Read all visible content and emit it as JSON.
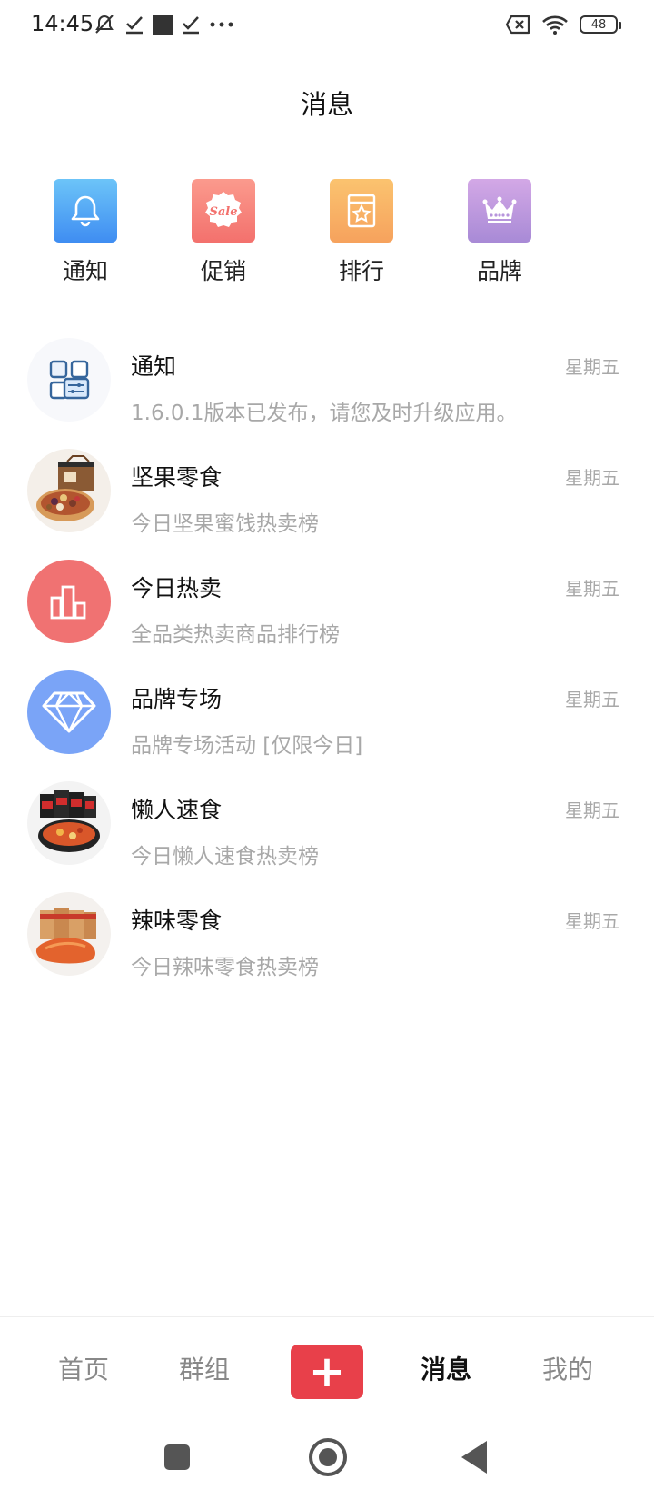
{
  "status_bar": {
    "time": "14:45",
    "left_icons": [
      "mute-icon",
      "check-icon",
      "square-icon",
      "check-icon",
      "more-icon"
    ],
    "right_icons": [
      "sim-off-icon",
      "wifi-icon",
      "battery-icon"
    ],
    "battery_level": "48"
  },
  "header": {
    "title": "消息"
  },
  "categories": [
    {
      "label": "通知",
      "icon": "bell-icon",
      "color": "#4a9cf6"
    },
    {
      "label": "促销",
      "icon": "sale-icon",
      "color": "#f77f7b"
    },
    {
      "label": "排行",
      "icon": "ranking-icon",
      "color": "#f8b26a"
    },
    {
      "label": "品牌",
      "icon": "crown-icon",
      "color": "#b795dc"
    }
  ],
  "messages": [
    {
      "title": "通知",
      "time": "星期五",
      "preview": "1.6.0.1版本已发布，请您及时升级应用。",
      "avatar": "notification-icon"
    },
    {
      "title": "坚果零食",
      "time": "星期五",
      "preview": "今日坚果蜜饯热卖榜",
      "avatar": "nuts-image"
    },
    {
      "title": "今日热卖",
      "time": "星期五",
      "preview": "全品类热卖商品排行榜",
      "avatar": "bar-chart-icon",
      "color": "#f07272"
    },
    {
      "title": "品牌专场",
      "time": "星期五",
      "preview": "品牌专场活动 [仅限今日]",
      "avatar": "diamond-icon",
      "color": "#7aa4f7"
    },
    {
      "title": "懒人速食",
      "time": "星期五",
      "preview": "今日懒人速食热卖榜",
      "avatar": "instant-food-image"
    },
    {
      "title": "辣味零食",
      "time": "星期五",
      "preview": "今日辣味零食热卖榜",
      "avatar": "spicy-snack-image"
    }
  ],
  "tabbar": {
    "tabs": [
      {
        "label": "首页",
        "active": false
      },
      {
        "label": "群组",
        "active": false
      },
      {
        "label": "消息",
        "active": true
      },
      {
        "label": "我的",
        "active": false
      }
    ],
    "plus_label": "+",
    "accent": "#e8404a"
  }
}
